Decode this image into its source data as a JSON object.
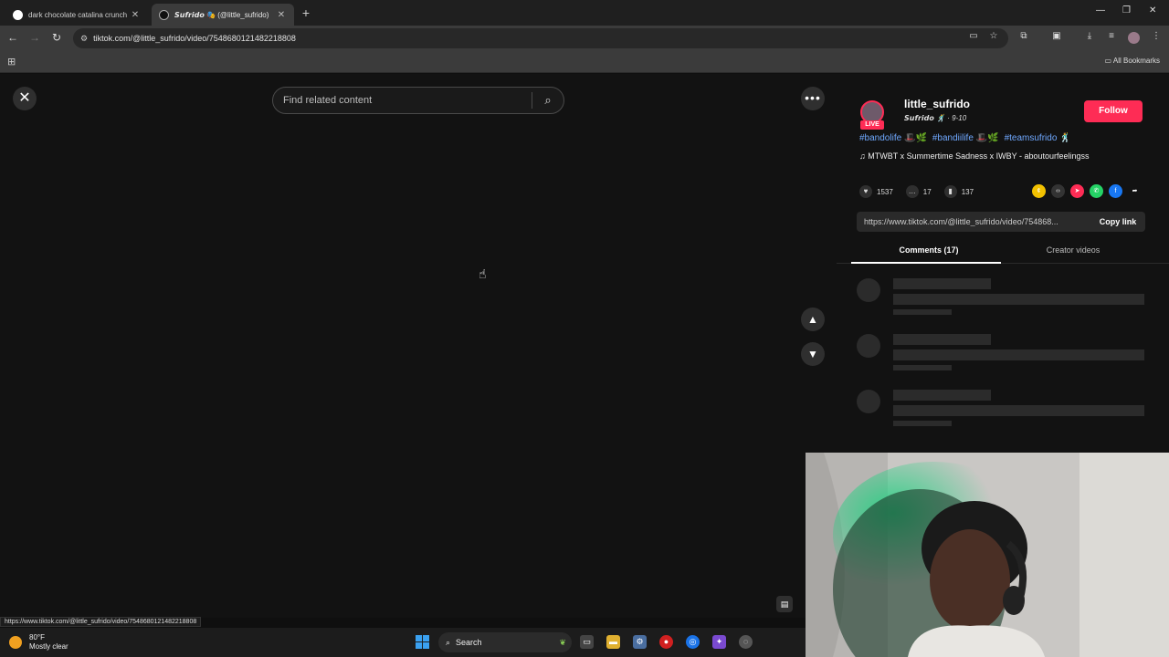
{
  "tabs": [
    {
      "title": "dark chocolate catalina crunch",
      "close": "✕"
    },
    {
      "title": "𝙎𝙪𝙛𝙧𝙞𝙙𝙤 🎭 (@little_sufrido)",
      "close": "✕"
    }
  ],
  "new_tab": "+",
  "window_controls": {
    "minimize": "—",
    "restore": "❐",
    "close": "✕"
  },
  "address_bar": {
    "url": "tiktok.com/@little_sufrido/video/7548680121482218808"
  },
  "bookmarks": {
    "all_label": "All Bookmarks"
  },
  "viewer": {
    "search_placeholder": "Find related content",
    "close_glyph": "✕",
    "more_glyph": "•••",
    "up_glyph": "⌃",
    "down_glyph": "⌄"
  },
  "panel": {
    "username": "little_sufrido",
    "nickname": "𝙎𝙪𝙛𝙧𝙞𝙙𝙤 🕺 · 9-10",
    "live_badge": "LIVE",
    "follow_label": "Follow",
    "hashtags": [
      "#bandolife",
      "#bandiilife",
      "#teamsufrido"
    ],
    "music": "♫  MTWBT x Summertime Sadness x IWBY - aboutourfeelingss",
    "likes": "1537",
    "comments": "17",
    "saves": "137",
    "share_link": "https://www.tiktok.com/@little_sufrido/video/754868...",
    "copy_label": "Copy link",
    "tab_comments": "Comments (17)",
    "tab_creator": "Creator videos"
  },
  "status_url": "https://www.tiktok.com/@little_sufrido/video/7548680121482218808",
  "taskbar": {
    "temperature": "80°F",
    "weather": "Mostly clear",
    "search_label": "Search"
  },
  "colors": {
    "accent": "#fe2c55",
    "hashtag": "#6fa8ff",
    "background": "#121212"
  }
}
